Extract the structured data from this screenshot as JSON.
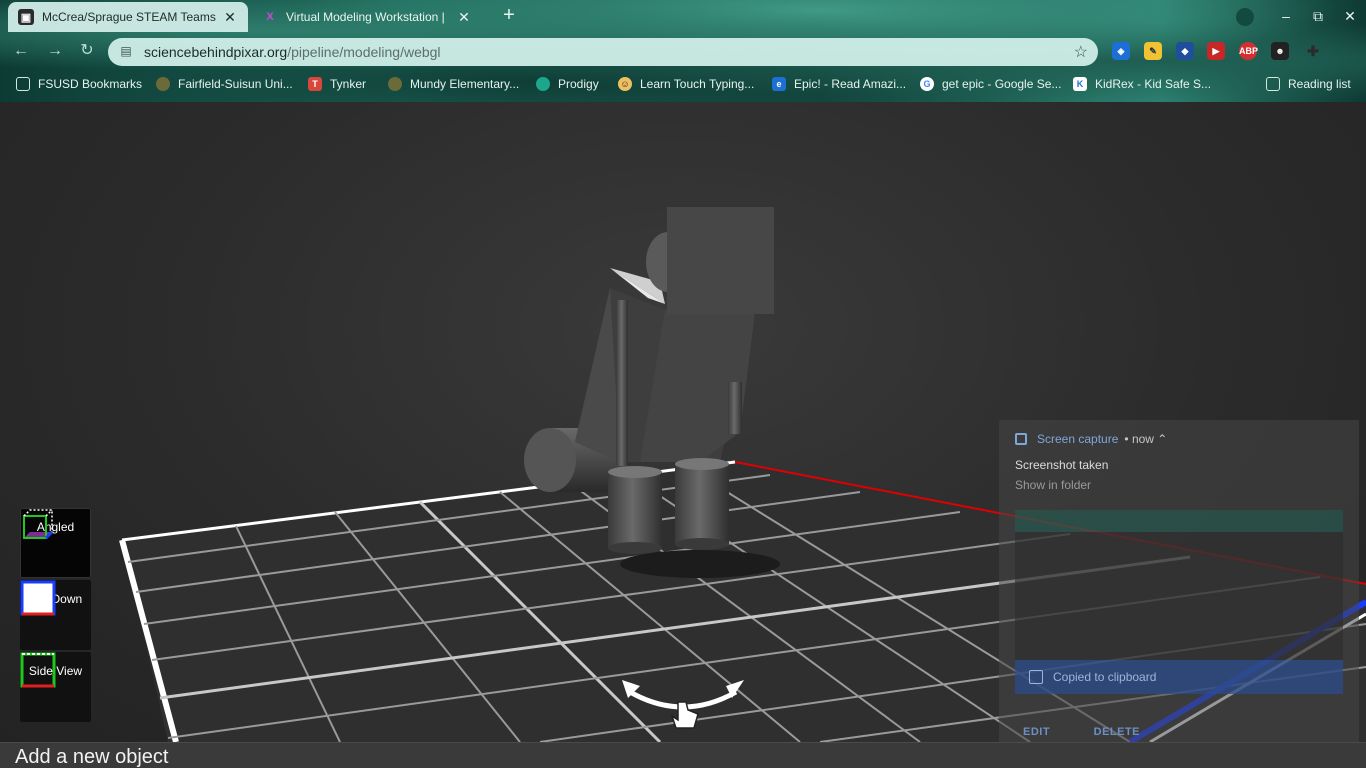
{
  "browser": {
    "tabs": [
      {
        "title": "McCrea/Sprague STEAM Teams",
        "active": true
      },
      {
        "title": "Virtual Modeling Workstation |",
        "active": false
      }
    ],
    "new_tab": "+",
    "window_controls": {
      "minimize": "–",
      "maximize": "⧉",
      "close": "✕"
    },
    "url_host": "sciencebehindpixar.org",
    "url_path": "/pipeline/modeling/webgl",
    "bookmarks": [
      "FSUSD Bookmarks",
      "Fairfield-Suisun Uni...",
      "Tynker",
      "Mundy Elementary...",
      "Prodigy",
      "Learn Touch Typing...",
      "Epic! - Read Amazi...",
      "get epic - Google Se...",
      "KidRex - Kid Safe S...",
      "Reading list"
    ],
    "extensions": [
      "ABP"
    ]
  },
  "views": [
    {
      "label": "Angled",
      "active": true
    },
    {
      "label": "Top Down",
      "active": false
    },
    {
      "label": "Side View",
      "active": false
    }
  ],
  "notification": {
    "app": "Screen capture",
    "when": "now",
    "title": "Screenshot taken",
    "subtitle": "Show in folder",
    "clipboard": "Copied to clipboard",
    "edit": "EDIT",
    "delete": "DELETE"
  },
  "bottom_bar": {
    "label": "Add a new object"
  },
  "colors": {
    "accent_blue": "#1a3cff",
    "accent_red": "#e00000",
    "grid_line": "#bdbdbd",
    "notif_link": "#7fa6d8"
  }
}
